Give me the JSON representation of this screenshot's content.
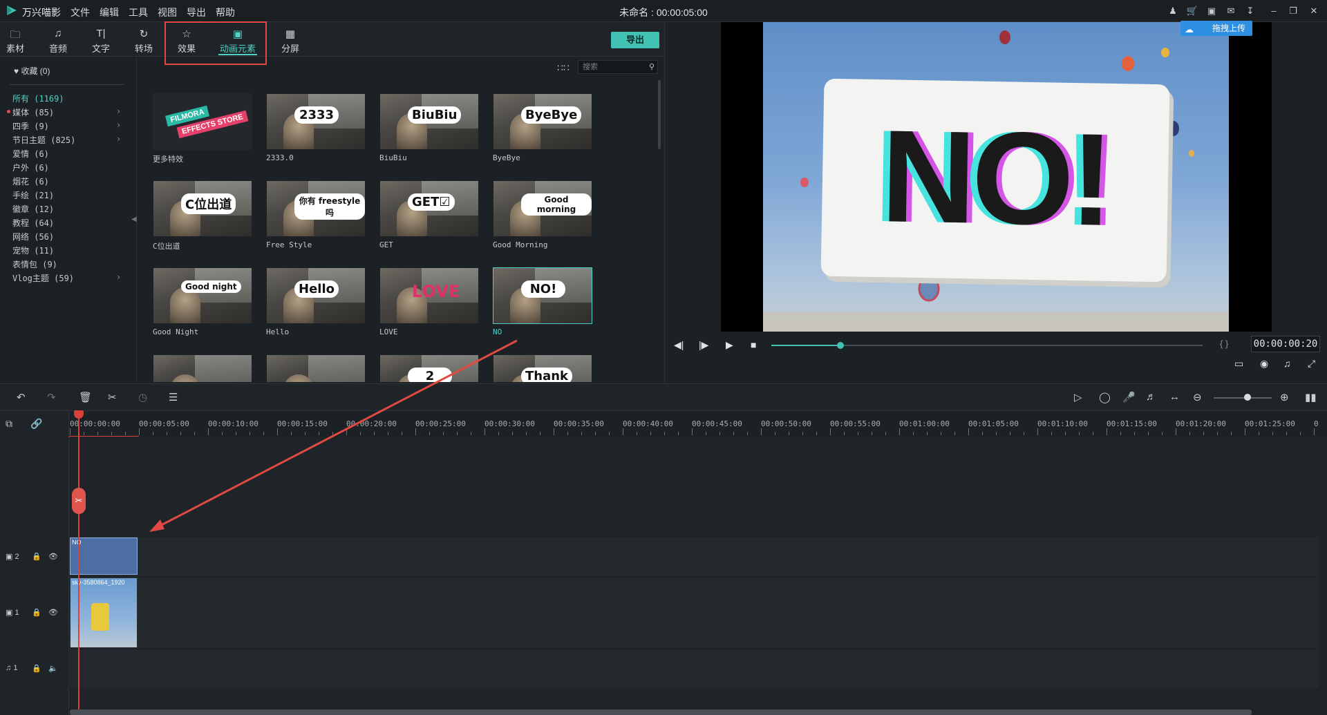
{
  "app": {
    "name": "万兴喵影",
    "window_title": "未命名 : 00:00:05:00",
    "menu": [
      "文件",
      "编辑",
      "工具",
      "视图",
      "导出",
      "帮助"
    ]
  },
  "tabs": [
    {
      "label": "素材",
      "icon": "folder-icon"
    },
    {
      "label": "音频",
      "icon": "music-note-icon"
    },
    {
      "label": "文字",
      "icon": "text-icon"
    },
    {
      "label": "转场",
      "icon": "transition-icon"
    },
    {
      "label": "效果",
      "icon": "effects-icon"
    },
    {
      "label": "动画元素",
      "icon": "image-icon",
      "active": true
    },
    {
      "label": "分屏",
      "icon": "split-screen-icon"
    }
  ],
  "export_label": "导出",
  "favorites": "收藏 (0)",
  "categories": [
    {
      "label": "所有 (1169)",
      "active": true
    },
    {
      "label": "媒体 (85)",
      "has_children": true
    },
    {
      "label": "四季 (9)",
      "has_children": true
    },
    {
      "label": "节日主题 (825)",
      "has_children": true
    },
    {
      "label": "爱情 (6)"
    },
    {
      "label": "户外 (6)"
    },
    {
      "label": "烟花 (6)"
    },
    {
      "label": "手绘 (21)"
    },
    {
      "label": "徽章 (12)"
    },
    {
      "label": "教程 (64)"
    },
    {
      "label": "网络 (56)"
    },
    {
      "label": "宠物 (11)"
    },
    {
      "label": "表情包 (9)"
    },
    {
      "label": "Vlog主题 (59)",
      "has_children": true
    }
  ],
  "search": {
    "placeholder": "搜索"
  },
  "elements": [
    {
      "label": "更多特效",
      "sticker": "",
      "store": true,
      "store_badge1": "FILMORA",
      "store_badge2": "EFFECTS STORE"
    },
    {
      "label": "2333.0",
      "sticker": "2333"
    },
    {
      "label": "BiuBiu",
      "sticker": "BiuBiu"
    },
    {
      "label": "ByeBye",
      "sticker": "ByeBye"
    },
    {
      "label": "C位出道",
      "sticker": "C位出道"
    },
    {
      "label": "Free Style",
      "sticker": "你有 freestyle 吗"
    },
    {
      "label": "GET",
      "sticker": "GET☑"
    },
    {
      "label": "Good Morning",
      "sticker": "Good morning"
    },
    {
      "label": "Good Night",
      "sticker": "Good night"
    },
    {
      "label": "Hello",
      "sticker": "Hello"
    },
    {
      "label": "LOVE",
      "sticker": "LOVE"
    },
    {
      "label": "NO",
      "sticker": "NO!",
      "selected": true
    },
    {
      "label": "",
      "sticker": ""
    },
    {
      "label": "",
      "sticker": ""
    },
    {
      "label": "",
      "sticker": "2"
    },
    {
      "label": "",
      "sticker": "Thank"
    }
  ],
  "preview": {
    "overlay_text": "NO!",
    "upload_label": "拖拽上传",
    "timecode": "00:00:00:20",
    "progress_fraction": 0.16
  },
  "timeline": {
    "ticks": [
      "00:00:00:00",
      "00:00:05:00",
      "00:00:10:00",
      "00:00:15:00",
      "00:00:20:00",
      "00:00:25:00",
      "00:00:30:00",
      "00:00:35:00",
      "00:00:40:00",
      "00:00:45:00",
      "00:00:50:00",
      "00:00:55:00",
      "00:01:00:00",
      "00:01:05:00",
      "00:01:10:00",
      "00:01:15:00",
      "00:01:20:00",
      "00:01:25:00",
      "0"
    ],
    "tracks": [
      {
        "label": "2",
        "clip": "NO"
      },
      {
        "label": "1",
        "clip": "sky-3580864_1920"
      },
      {
        "label": "1",
        "clip": ""
      }
    ]
  },
  "colors": {
    "accent": "#4fd0c4",
    "highlight_red": "#e04a43",
    "playhead": "#d9423a"
  }
}
